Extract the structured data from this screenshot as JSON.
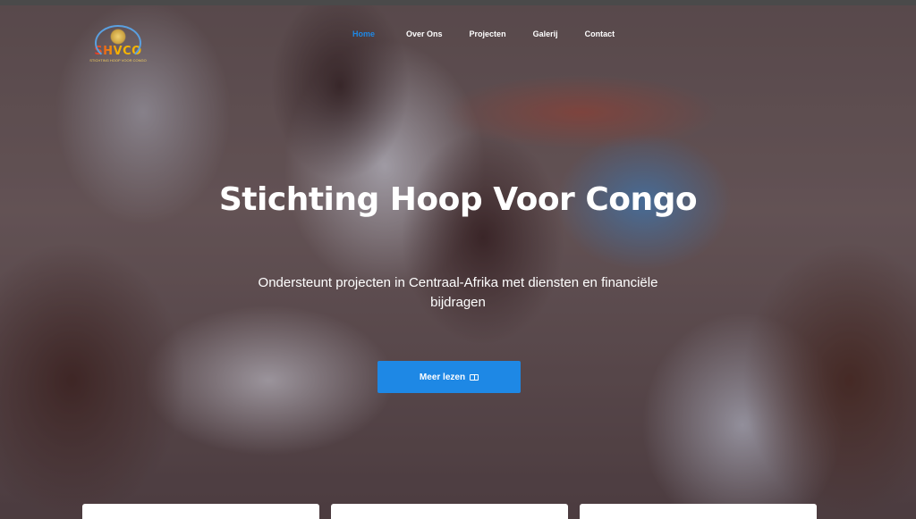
{
  "logo": {
    "text": "SHVCO",
    "subtext": "STICHTING HOOP VOOR CONGO"
  },
  "nav": {
    "items": [
      {
        "label": "Home",
        "active": true
      },
      {
        "label": "Over Ons",
        "active": false
      },
      {
        "label": "Projecten",
        "active": false
      },
      {
        "label": "Galerij",
        "active": false
      },
      {
        "label": "Contact",
        "active": false
      }
    ]
  },
  "hero": {
    "title": "Stichting Hoop Voor Congo",
    "subtitle": "Ondersteunt projecten in Centraal-Afrika met diensten en financiële bijdragen",
    "cta_label": "Meer lezen",
    "cta_icon": "book-icon"
  },
  "colors": {
    "accent": "#1e88e5",
    "text": "#ffffff"
  }
}
